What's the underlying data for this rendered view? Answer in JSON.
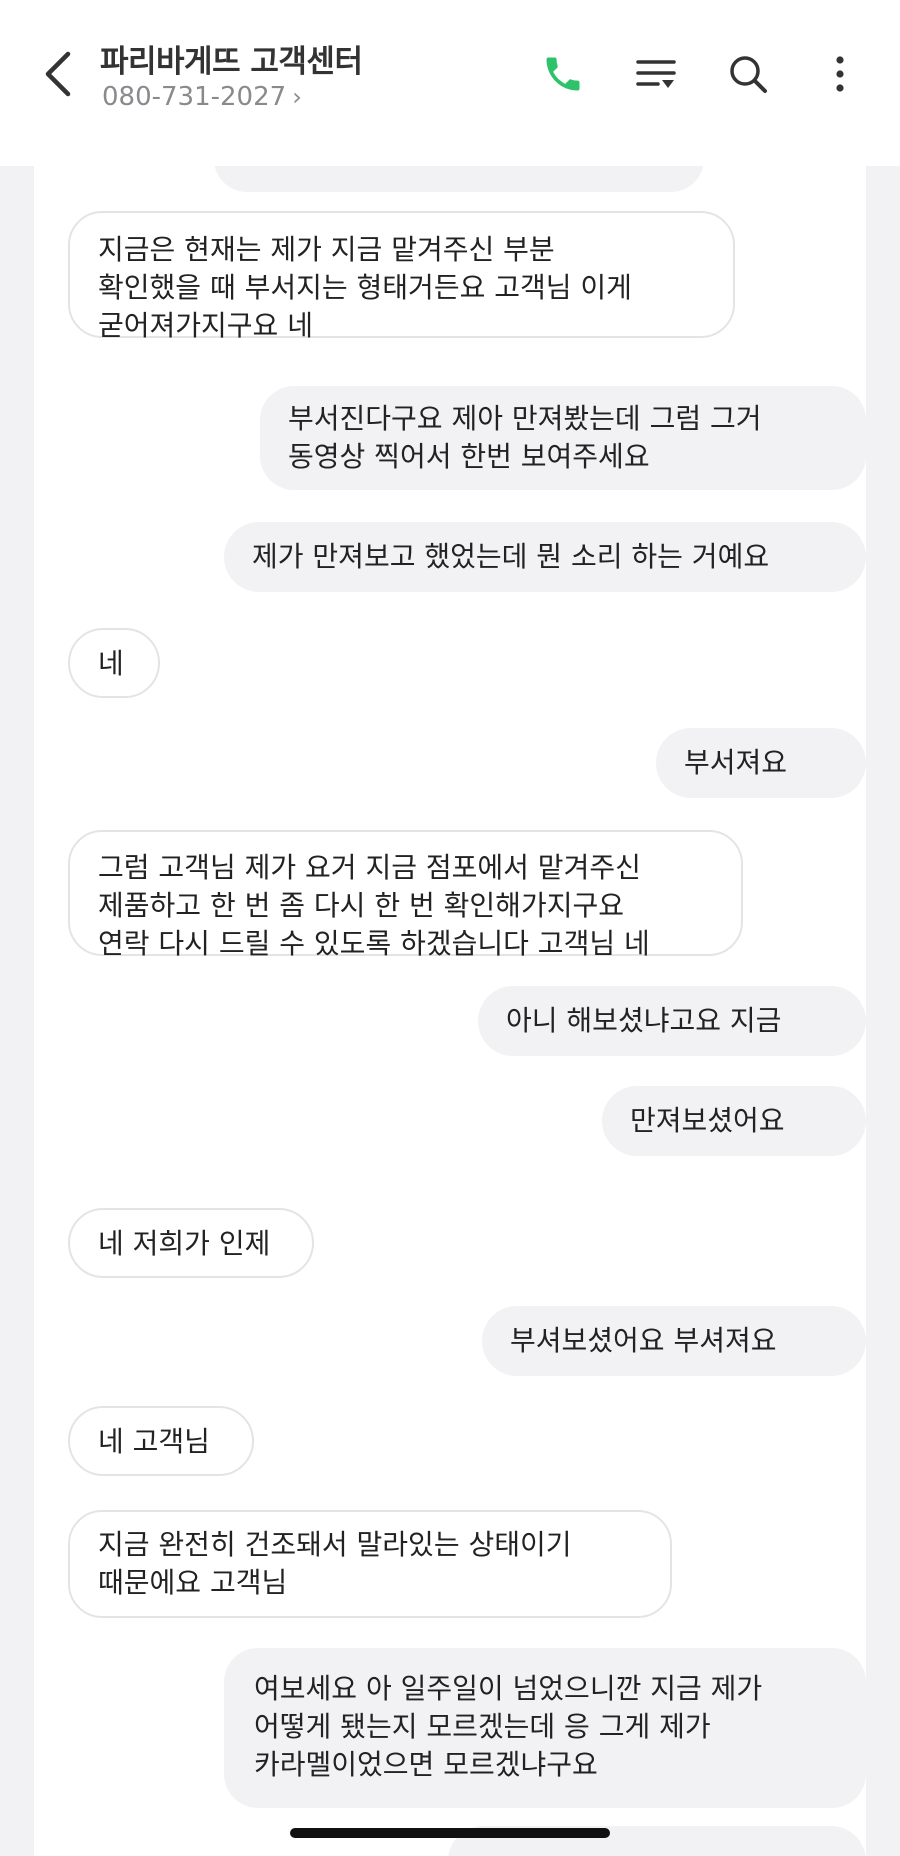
{
  "header": {
    "title": "파리바게뜨 고객센터",
    "phone_number": "080-731-2027",
    "phone_chevron": "›",
    "icons": {
      "back": "chevron-left-icon",
      "call": "phone-icon",
      "filter": "list-filter-icon",
      "search": "search-icon",
      "more": "more-vertical-icon"
    },
    "accent_color": "#2ec36b"
  },
  "messages": [
    {
      "side": "in",
      "text": "지금은 현재는 제가 지금 맡겨주신 부분\n확인했을 때 부서지는 형태거든요 고객님 이게\n굳어져가지구요 네"
    },
    {
      "side": "out",
      "text": "부서진다구요 제아 만져봤는데 그럼 그거\n동영상 찍어서 한번 보여주세요"
    },
    {
      "side": "out",
      "text": "제가 만져보고 했었는데 뭔 소리 하는 거예요"
    },
    {
      "side": "in",
      "text": "네"
    },
    {
      "side": "out",
      "text": "부서져요"
    },
    {
      "side": "in",
      "text": "그럼 고객님 제가 요거 지금 점포에서 맡겨주신\n제품하고 한 번 좀 다시 한 번 확인해가지구요\n연락 다시 드릴 수 있도록 하겠습니다 고객님 네"
    },
    {
      "side": "out",
      "text": "아니 해보셨냐고요 지금"
    },
    {
      "side": "out",
      "text": "만져보셨어요"
    },
    {
      "side": "in",
      "text": "네 저희가 인제"
    },
    {
      "side": "out",
      "text": "부셔보셨어요 부셔져요"
    },
    {
      "side": "in",
      "text": "네 고객님"
    },
    {
      "side": "in",
      "text": "지금 완전히 건조돼서 말라있는 상태이기\n때문에요 고객님"
    },
    {
      "side": "out",
      "text": "여보세요 아 일주일이 넘었으니깐 지금 제가\n어떻게 됐는지 모르겠는데 응 그게 제가\n카라멜이었으면 모르겠냐구요"
    }
  ]
}
